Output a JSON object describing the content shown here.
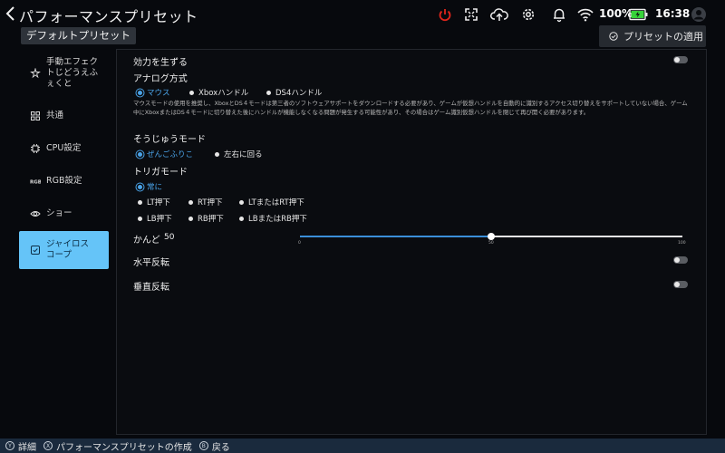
{
  "header": {
    "title": "パフォーマンスプリセット",
    "battery_percent": "100%",
    "time": "16:38",
    "icons": [
      "back-icon",
      "power-icon",
      "fullscreen-icon",
      "cloud-upload-icon",
      "gear-icon",
      "bell-icon",
      "wifi-icon",
      "battery-icon",
      "user-icon"
    ],
    "battery_level": 1.0,
    "power_color": "#e0251b",
    "battery_color": "#38d43a"
  },
  "preset_tag": "デフォルトプリセット",
  "apply_button": "プリセットの適用",
  "sidebar": {
    "items": [
      {
        "label": "手動エフェクトじどうえふぇくと",
        "icon": "manual-effect-icon"
      },
      {
        "label": "共通",
        "icon": "grid-icon"
      },
      {
        "label": "CPU設定",
        "icon": "cpu-icon"
      },
      {
        "label": "RGB設定",
        "icon": "rgb-icon"
      },
      {
        "label": "ショー",
        "icon": "eye-icon"
      },
      {
        "label": "ジャイロスコープ",
        "icon": "gyroscope-icon"
      }
    ],
    "active_index": 5,
    "accent": "#65c4f8"
  },
  "content": {
    "enable_label": "効力を生ずる",
    "enable_on": false,
    "analog_title": "アナログ方式",
    "analog_options": [
      "マウス",
      "Xboxハンドル",
      "DS4ハンドル"
    ],
    "analog_selected": 0,
    "analog_desc": "マウスモードの使用を推奨し、XboxとDS４モードは第三者のソフトウェアサポートをダウンロードする必要があり、ゲームが仮想ハンドルを自動的に識別するアクセス切り替えをサポートしていない場合、ゲーム中にXboxまたはDS４モードに切り替えた後にハンドルが機能しなくなる問題が発生する可能性があり、その場合はゲーム識別仮想ハンドルを閉じて再び開く必要があります。",
    "steer_title": "そうじゅうモード",
    "steer_options": [
      "ぜんごふりこ",
      "左右に回る"
    ],
    "steer_selected": 0,
    "trigger_title": "トリガモード",
    "trigger_options": [
      "常に",
      "LT押下",
      "RT押下",
      "LTまたはRT押下",
      "LB押下",
      "RB押下",
      "LBまたはRB押下"
    ],
    "trigger_selected": 0,
    "sensitivity_label": "かんど",
    "sensitivity_value": "50",
    "slider": {
      "min": 0,
      "max": 100,
      "value": 50,
      "tick_min": "0",
      "tick_mid": "50",
      "tick_max": "100"
    },
    "horizontal_invert_label": "水平反転",
    "horizontal_invert_on": false,
    "vertical_invert_label": "垂直反転",
    "vertical_invert_on": false,
    "accent": "#4aa3e8"
  },
  "footer": {
    "items": [
      {
        "label": "詳細",
        "icon": "y-button-icon"
      },
      {
        "label": "パフォーマンスプリセットの作成",
        "icon": "x-button-icon"
      },
      {
        "label": "戻る",
        "icon": "b-button-icon"
      }
    ]
  }
}
